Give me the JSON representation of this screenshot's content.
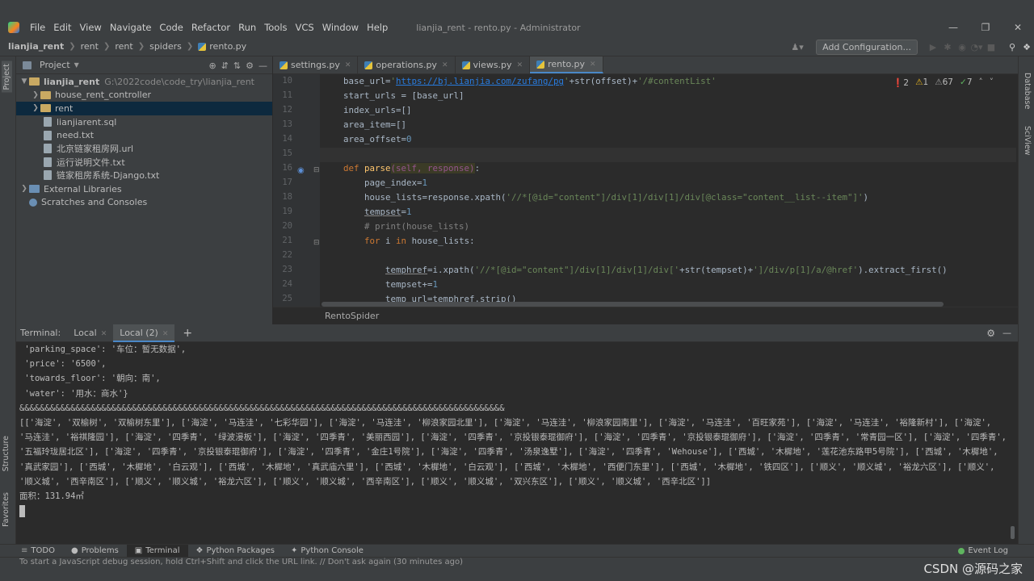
{
  "window": {
    "title": "lianjia_rent - rento.py - Administrator"
  },
  "menu": [
    "File",
    "Edit",
    "View",
    "Navigate",
    "Code",
    "Refactor",
    "Run",
    "Tools",
    "VCS",
    "Window",
    "Help"
  ],
  "breadcrumb": [
    "lianjia_rent",
    "rent",
    "rent",
    "spiders",
    "rento.py"
  ],
  "toolbar": {
    "add_config": "Add Configuration..."
  },
  "project": {
    "header": "Project",
    "tree": [
      {
        "label": "lianjia_rent",
        "extra": "G:\\2022code\\code_try\\lianjia_rent"
      },
      {
        "label": "house_rent_controller"
      },
      {
        "label": "rent"
      },
      {
        "label": "lianjiarent.sql"
      },
      {
        "label": "need.txt"
      },
      {
        "label": "北京链家租房网.url"
      },
      {
        "label": "运行说明文件.txt"
      },
      {
        "label": "链家租房系统-Django.txt"
      },
      {
        "label": "External Libraries"
      },
      {
        "label": "Scratches and Consoles"
      }
    ]
  },
  "tabs": [
    "settings.py",
    "operations.py",
    "views.py",
    "rento.py"
  ],
  "inspections": {
    "errors": "2",
    "warnings": "1",
    "weak": "67",
    "ok": "7"
  },
  "line_numbers": [
    "10",
    "11",
    "12",
    "13",
    "14",
    "15",
    "16",
    "17",
    "18",
    "19",
    "20",
    "21",
    "22",
    "23",
    "24",
    "25"
  ],
  "editor_breadcrumb": "RentoSpider",
  "terminal": {
    "label": "Terminal:",
    "tabs": [
      "Local",
      "Local (2)"
    ],
    "lines": [
      " 'parking_space': '车位：暂无数据',",
      " 'price': '6500',",
      " 'towards_floor': '朝向：南',",
      " 'water': '用水：商水'}",
      "&&&&&&&&&&&&&&&&&&&&&&&&&&&&&&&&&&&&&&&&&&&&&&&&&&&&&&&&&&&&&&&&&&&&&&&&&&&&&&&&&&&&&&&&&&&&&&&",
      "[['海淀', '双榆树', '双榆树东里'], ['海淀', '马连洼', '七彩华园'], ['海淀', '马连洼', '柳浪家园北里'], ['海淀', '马连洼', '柳浪家园南里'], ['海淀', '马连洼', '百旺家苑'], ['海淀', '马连洼', '裕隆新村'], ['海淀', '马连洼', '裕祺隆园'], ['海淀', '四季青', '绿波漫板'], ['海淀', '四季青', '美丽西园'], ['海淀', '四季青', '京投银泰琨御府'], ['海淀', '四季青', '京投银泰琨御府'], ['海淀', '四季青', '常青园一区'], ['海淀', '四季青', '五福玲珑居北区'], ['海淀', '四季青', '京投银泰琨御府'], ['海淀', '四季青', '金庄1号院'], ['海淀', '四季青', '汤泉逸墅'], ['海淀', '四季青', 'Wehouse'], ['西城', '木樨地', '莲花池东路甲5号院'], ['西城', '木樨地', '真武家园'], ['西城', '木樨地', '白云观'], ['西城', '木樨地', '真武庙六里'], ['西城', '木樨地', '白云观'], ['西城', '木樨地', '西便门东里'], ['西城', '木樨地', '铁四区'], ['顺义', '顺义城', '裕龙六区'], ['顺义', '顺义城', '西辛南区'], ['顺义', '顺义城', '裕龙六区'], ['顺义', '顺义城', '西辛南区'], ['顺义', '顺义城', '双兴东区'], ['顺义', '顺义城', '西辛北区']]",
      "面积：131.94㎡"
    ]
  },
  "bottom_tabs": [
    "TODO",
    "Problems",
    "Terminal",
    "Python Packages",
    "Python Console",
    "Event Log"
  ],
  "status": {
    "message": "To start a JavaScript debug session, hold Ctrl+Shift and click the URL link. // Don't ask again (30 minutes ago)"
  },
  "side_tabs": {
    "left": [
      "Project",
      "Structure",
      "Favorites"
    ],
    "right": [
      "Database",
      "SciView"
    ]
  },
  "watermark": "CSDN @源码之家"
}
